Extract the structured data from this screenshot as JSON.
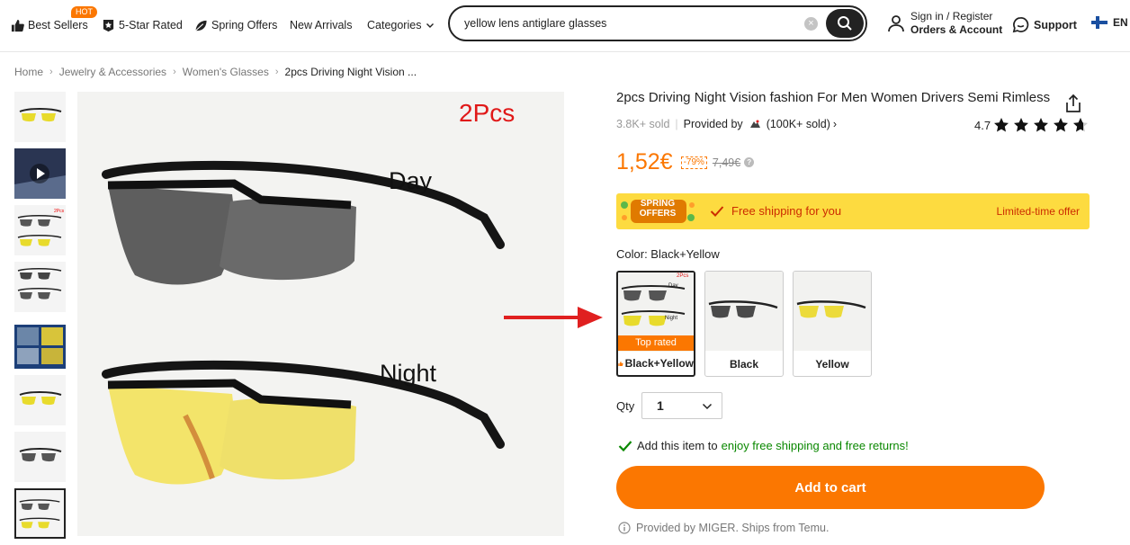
{
  "nav": {
    "items": [
      {
        "label": "Best Sellers",
        "badge": "HOT",
        "icon": "thumbs-up-icon"
      },
      {
        "label": "5-Star Rated",
        "icon": "star-badge-icon"
      },
      {
        "label": "Spring Offers",
        "icon": "leaf-icon"
      },
      {
        "label": "New Arrivals"
      },
      {
        "label": "Categories",
        "icon": "chevron-down-icon"
      }
    ]
  },
  "search": {
    "value": "yellow lens antiglare glasses"
  },
  "account": {
    "line1": "Sign in / Register",
    "line2": "Orders & Account"
  },
  "support": {
    "label": "Support"
  },
  "lang": {
    "label": "EN"
  },
  "breadcrumb": [
    "Home",
    "Jewelry & Accessories",
    "Women's Glasses",
    "2pcs Driving Night Vision ..."
  ],
  "main_image": {
    "tag": "2Pcs",
    "day": "Day",
    "night": "Night"
  },
  "product": {
    "title": "2pcs Driving Night Vision fashion For Men Women Drivers Semi Rimless",
    "sold": "3.8K+ sold",
    "provided_by": "Provided by",
    "store_sold": "(100K+ sold)",
    "rating": "4.7",
    "stars": 4.7,
    "price": "1,52€",
    "discount": "-79%",
    "original_price": "7,49€"
  },
  "promo": {
    "logo_line1": "SPRING",
    "logo_line2": "OFFERS",
    "free_shipping": "Free shipping for you",
    "limited": "Limited-time offer"
  },
  "color": {
    "label": "Color: Black+Yellow",
    "options": [
      {
        "label": "Black+Yellow",
        "badge": "Top rated",
        "thumb_tag": "2Pcs",
        "thumb_day": "Day",
        "thumb_night": "Night"
      },
      {
        "label": "Black"
      },
      {
        "label": "Yellow"
      }
    ]
  },
  "qty": {
    "label": "Qty",
    "value": "1"
  },
  "free_ship_note": {
    "prefix": "Add this item to",
    "link": "enjoy free shipping and free returns!"
  },
  "cart": {
    "label": "Add to cart"
  },
  "provided_note": "Provided by MIGER. Ships from Temu.",
  "colors": {
    "accent": "#fb7701",
    "promo_bg": "#fddb40",
    "green": "#0a8800",
    "arrow": "#e02020"
  }
}
